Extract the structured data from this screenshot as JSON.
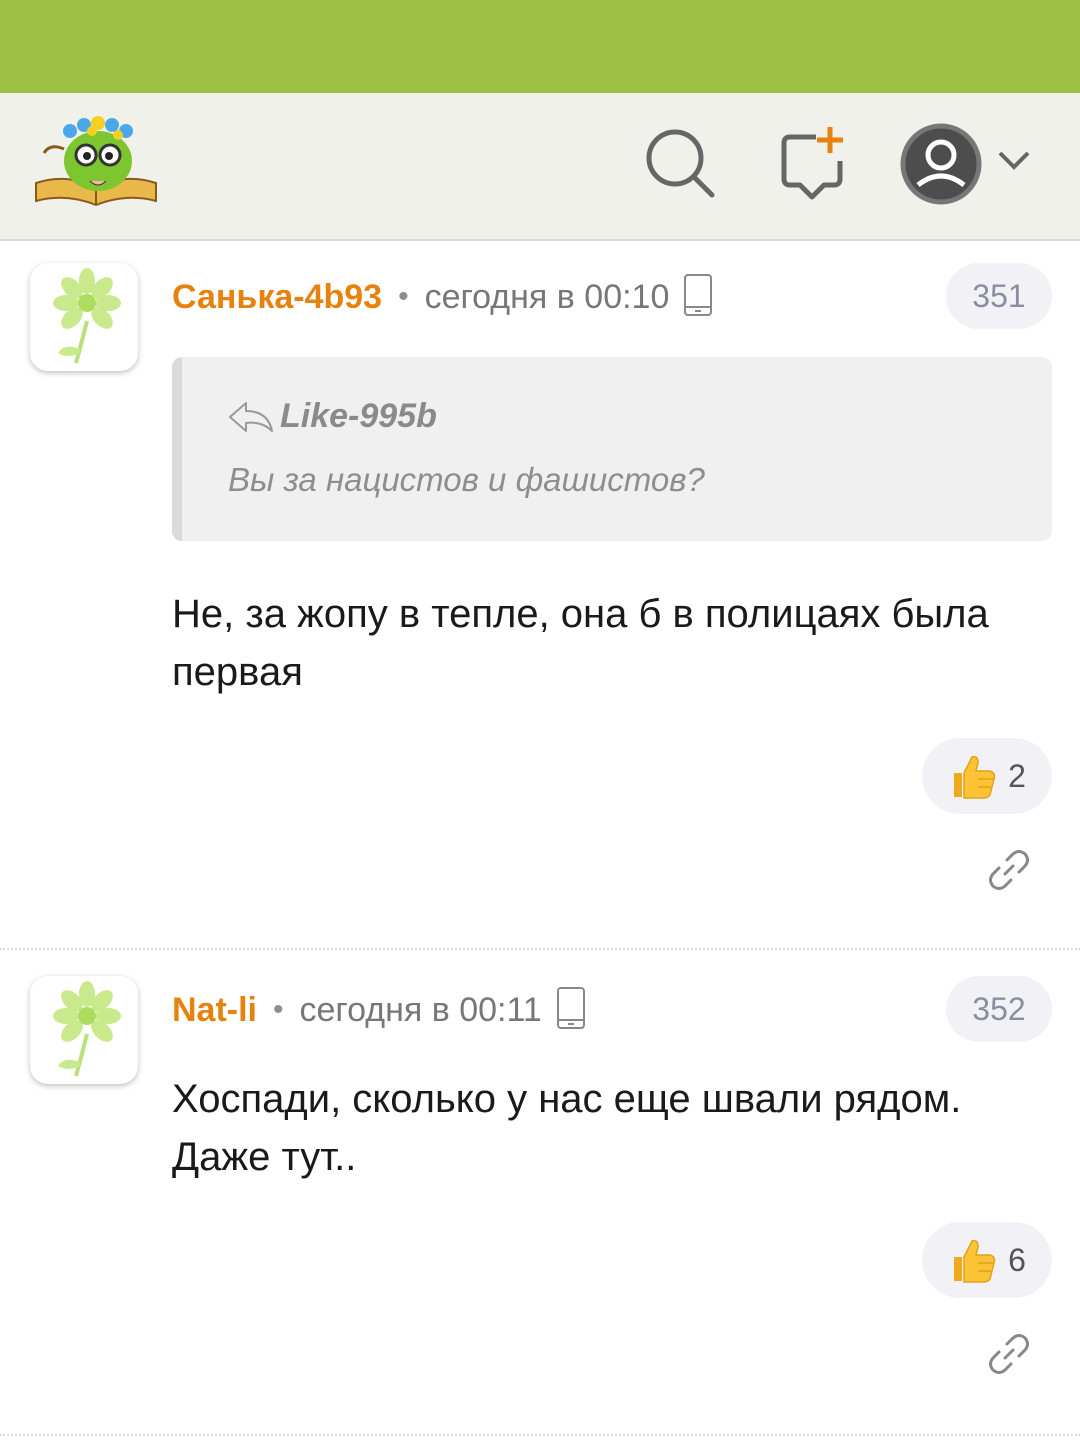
{
  "comments": [
    {
      "author": "Санька-4b93",
      "separator": "•",
      "time": "сегодня в 00:10",
      "number": "351",
      "quote": {
        "author": "Like-995b",
        "text": "Вы за нацистов и фашистов?"
      },
      "text": "Не, за жопу в тепле, она б в полицаях была первая",
      "likes": "2"
    },
    {
      "author": "Nat-li",
      "separator": "•",
      "time": "сегодня в 00:11",
      "number": "352",
      "text": "Хоспади, сколько у нас еще швали рядом. Даже тут..",
      "likes": "6"
    }
  ],
  "colors": {
    "statusbar": "#9dc144",
    "header_bg": "#f1f1ec",
    "author": "#e8820f",
    "badge_bg": "#f2f2f6"
  },
  "icons": [
    "site-logo",
    "search-icon",
    "new-post-icon",
    "user-avatar-icon",
    "chevron-down-icon",
    "flower-icon",
    "phone-icon",
    "reply-icon",
    "thumbs-up-icon",
    "link-icon"
  ]
}
